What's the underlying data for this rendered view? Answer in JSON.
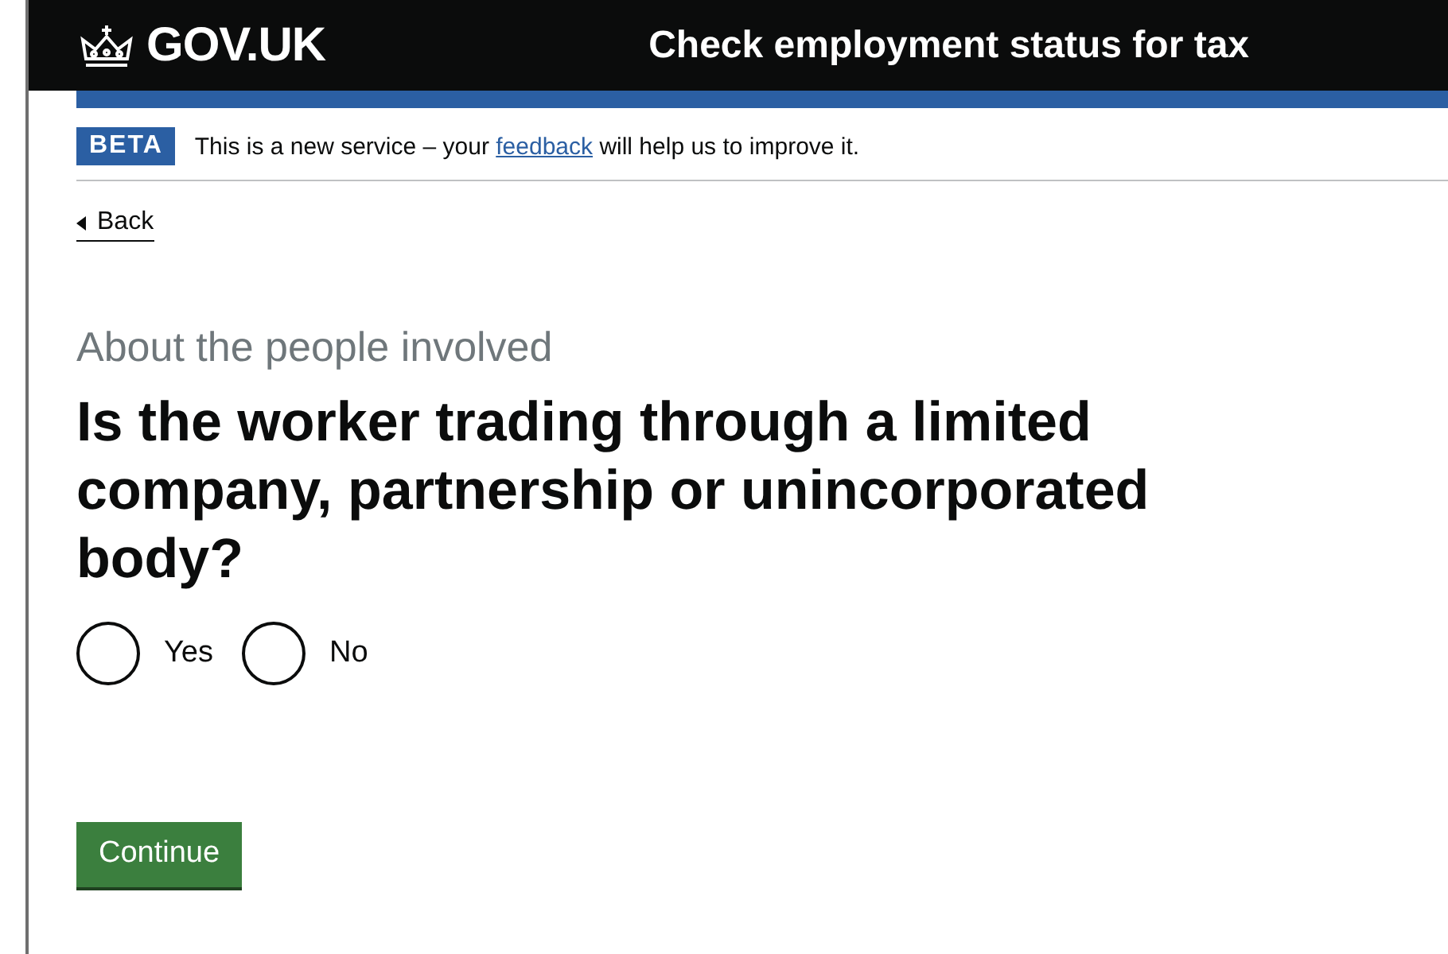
{
  "header": {
    "logo": "GOV.UK",
    "service_name": "Check employment status for tax"
  },
  "phase_banner": {
    "tag": "BETA",
    "text_before": "This is a new service – your",
    "link": "feedback",
    "text_after": "will help us to improve it."
  },
  "back_link": {
    "label": "Back"
  },
  "caption": "About the people involved",
  "question": "Is the worker trading through a limited company, partnership or unincorporated body?",
  "options": [
    {
      "label": "Yes",
      "selected": false
    },
    {
      "label": "No",
      "selected": false
    }
  ],
  "button": {
    "label": "Continue"
  }
}
